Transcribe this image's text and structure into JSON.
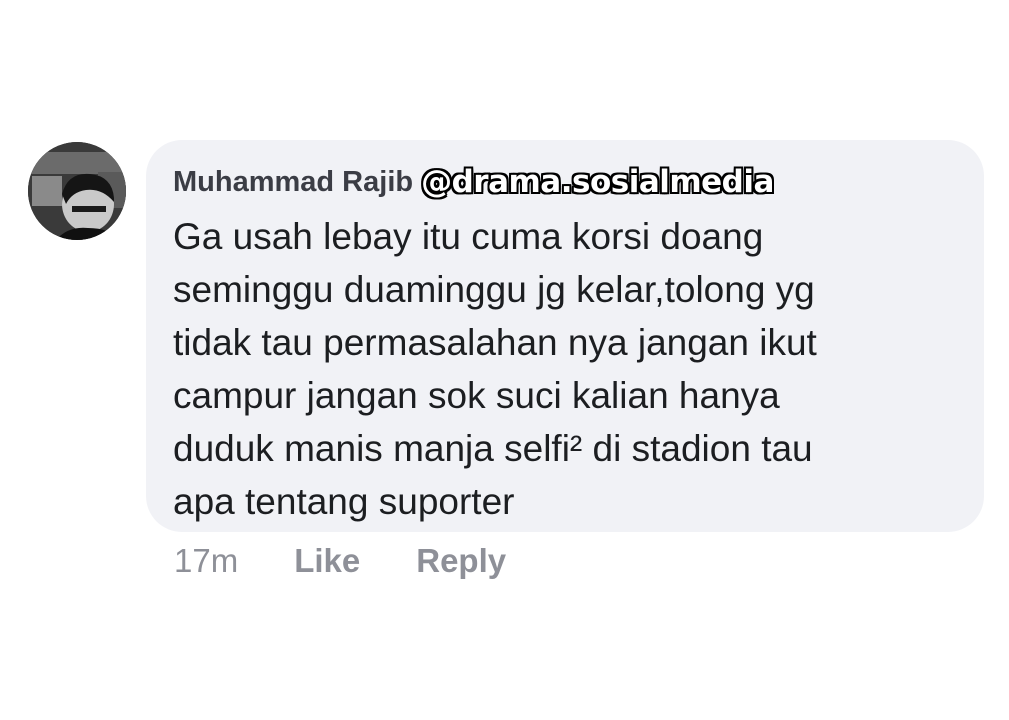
{
  "comment": {
    "author": "Muhammad Rajib",
    "watermark": "@drama.sosialmedia",
    "lines": [
      "Ga usah lebay itu cuma korsi doang",
      "seminggu duaminggu jg kelar,tolong yg",
      "tidak tau permasalahan nya jangan ikut",
      "campur jangan sok suci kalian hanya",
      "duduk manis manja selfi² di stadion tau",
      "apa tentang suporter"
    ],
    "timestamp": "17m",
    "like_label": "Like",
    "reply_label": "Reply"
  },
  "colors": {
    "bubble": "#f1f2f6",
    "author": "#3b3d45",
    "text": "#1c1e21",
    "meta": "#8e9098"
  },
  "icons": {
    "avatar": "profile-photo"
  }
}
